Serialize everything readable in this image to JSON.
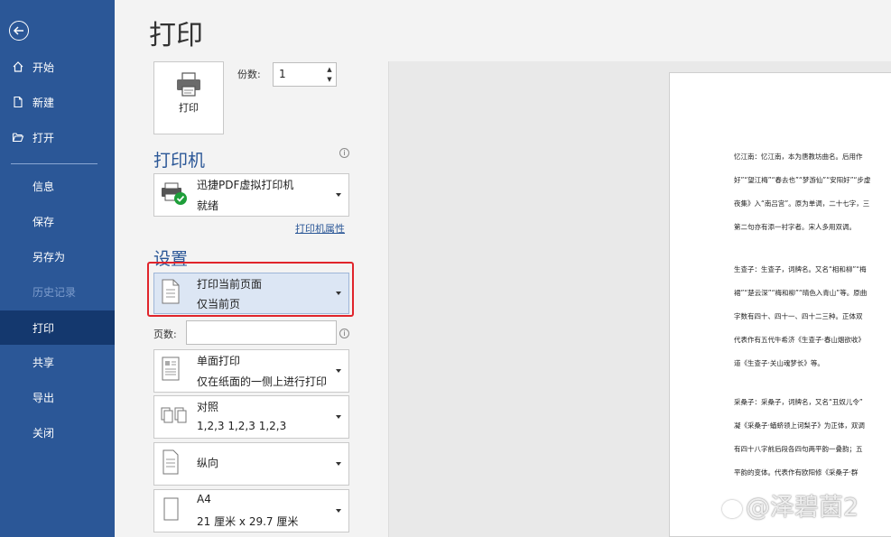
{
  "sidebar": {
    "items": [
      {
        "label": "开始",
        "icon": "home-icon"
      },
      {
        "label": "新建",
        "icon": "new-file-icon"
      },
      {
        "label": "打开",
        "icon": "folder-open-icon"
      },
      {
        "label": "信息"
      },
      {
        "label": "保存"
      },
      {
        "label": "另存为"
      },
      {
        "label": "历史记录",
        "disabled": true
      },
      {
        "label": "打印",
        "active": true
      },
      {
        "label": "共享"
      },
      {
        "label": "导出"
      },
      {
        "label": "关闭"
      }
    ]
  },
  "main": {
    "title": "打印",
    "print_button_label": "打印",
    "copies_label": "份数:",
    "copies_value": "1"
  },
  "printer": {
    "section_title": "打印机",
    "name": "迅捷PDF虚拟打印机",
    "status": "就绪",
    "properties_link": "打印机属性"
  },
  "settings": {
    "section_title": "设置",
    "range": {
      "line1": "打印当前页面",
      "line2": "仅当前页"
    },
    "pages_label": "页数:",
    "pages_value": "",
    "sides": {
      "line1": "单面打印",
      "line2": "仅在纸面的一侧上进行打印"
    },
    "collate": {
      "line1": "对照",
      "line2": "1,2,3    1,2,3    1,2,3"
    },
    "orientation": {
      "line1": "纵向"
    },
    "paper": {
      "line1": "A4",
      "line2": "21 厘米 x 29.7 厘米"
    }
  },
  "preview": {
    "paragraphs": [
      [
        "忆江南：忆江南，本为唐教坊曲名。后用作",
        "好”“望江梅”“春去也”“梦游仙”“安阳好”“步虚",
        "夜集》入“南吕宫”。原为单调，二十七字，三",
        "第二句亦有添一衬字者。宋人多用双调。"
      ],
      [
        "生查子：生查子，词牌名。又名“相和柳”“梅",
        "裙”“楚云深”“梅和柳”“晴色入青山”等。原曲",
        "字数有四十、四十一、四十二三种。正体双",
        "代表作有五代牛希济《生查子·春山烟欲收》",
        "道《生查子·关山魂梦长》等。"
      ],
      [
        "采桑子：采桑子，词牌名，又名“丑奴儿令”",
        "凝《采桑子·蝤蛴领上诃梨子》为正体，双调",
        "有四十八字前后段各四句两平韵一叠韵；五",
        "平韵的变体。代表作有欧阳修《采桑子·群"
      ]
    ]
  },
  "watermark": "@泽碧菌2",
  "colors": {
    "sidebar": "#2b5797",
    "active": "#14386e",
    "highlight": "#e0242b",
    "accent": "#2b5797"
  }
}
